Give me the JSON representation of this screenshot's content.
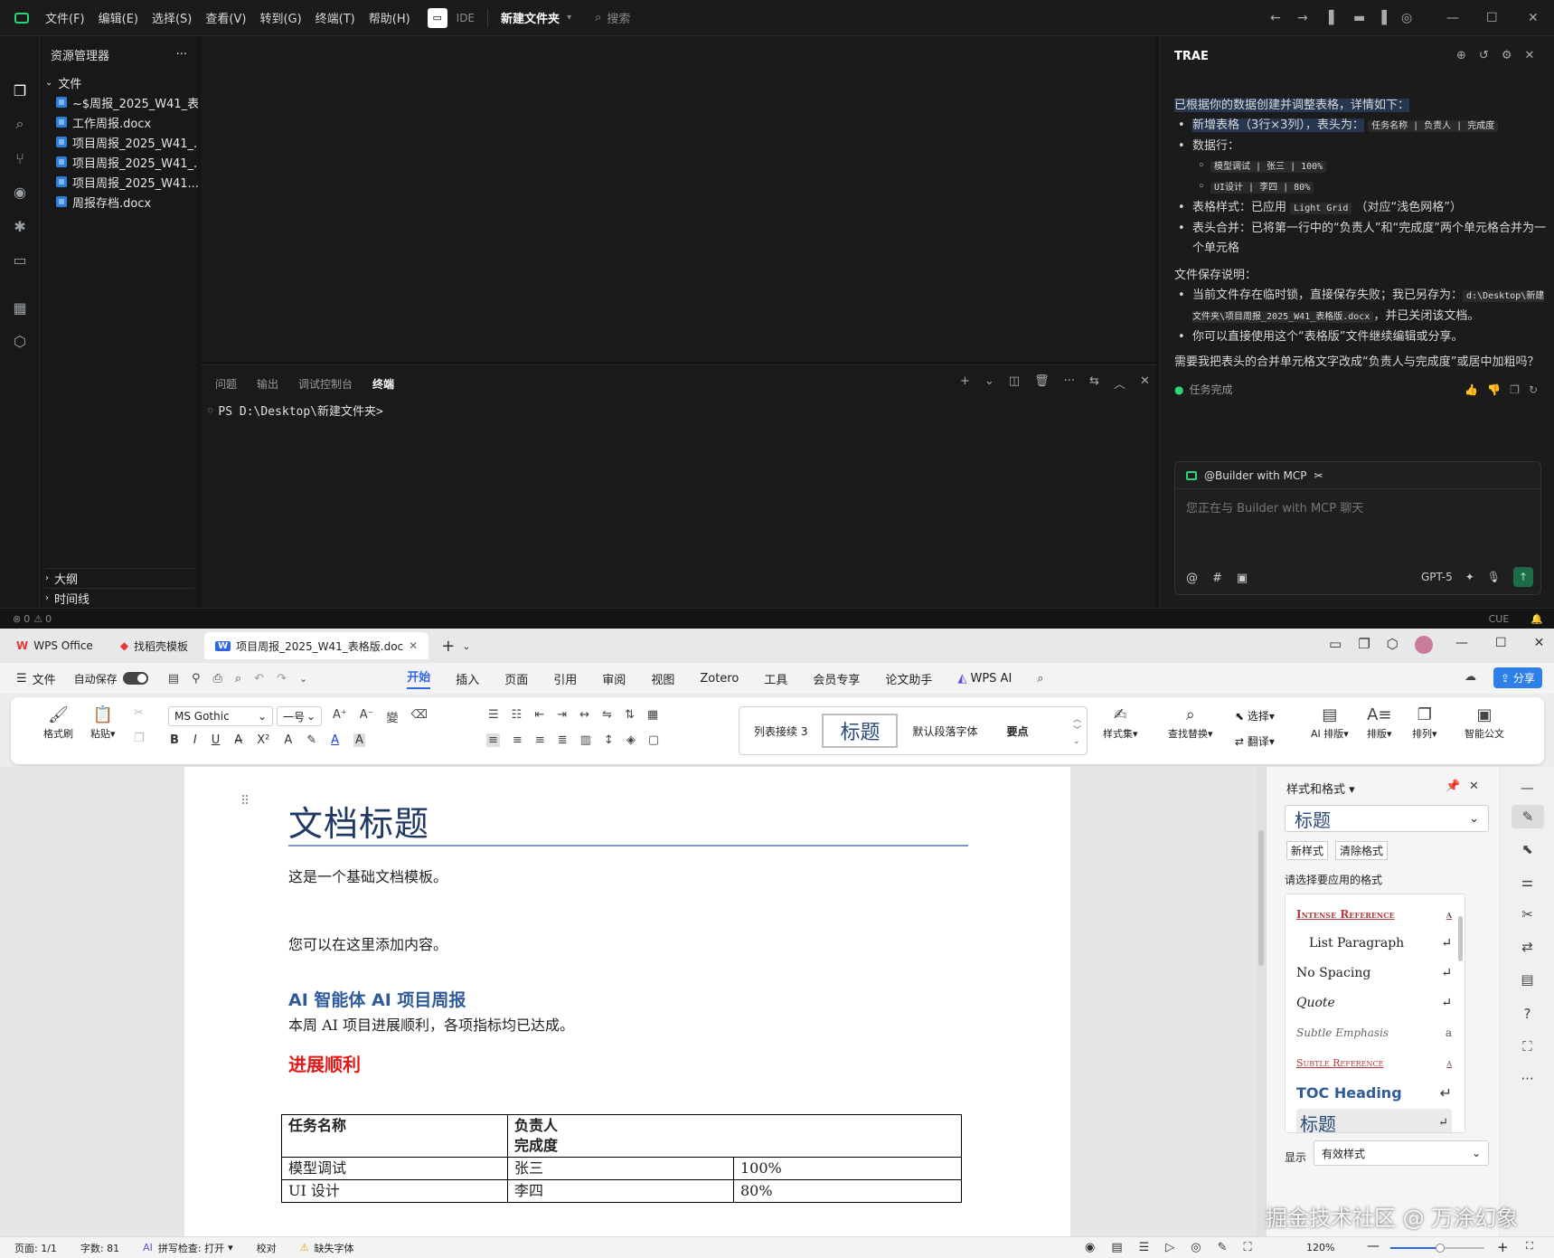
{
  "ide": {
    "menu": [
      "文件(F)",
      "编辑(E)",
      "选择(S)",
      "查看(V)",
      "转到(G)",
      "终端(T)",
      "帮助(H)"
    ],
    "mode_label": "IDE",
    "project": "新建文件夹",
    "search_placeholder": "搜索",
    "explorer": {
      "title": "资源管理器",
      "root": "文件",
      "files": [
        "~$周报_2025_W41_表...",
        "工作周报.docx",
        "项目周报_2025_W41_...",
        "项目周报_2025_W41_...",
        "项目周报_2025_W41....",
        "周报存档.docx"
      ],
      "outline": "大纲",
      "timeline": "时间线"
    },
    "panel": {
      "tabs": [
        "问题",
        "输出",
        "调试控制台",
        "终端"
      ],
      "active_tab": "终端",
      "prompt": "PS D:\\Desktop\\新建文件夹>"
    },
    "status": {
      "errors": "0",
      "warnings": "0",
      "right": "CUE"
    }
  },
  "trae": {
    "title": "TRAE",
    "intro": "已根据你的数据创建并调整表格，详情如下：",
    "b1_a": "新增表格（3行×3列），表头为：",
    "b1_code": "任务名称 | 负责人 | 完成度",
    "b2": "数据行：",
    "row1": "模型调试 | 张三 | 100%",
    "row2": "UI设计 | 李四 | 80%",
    "b3_a": "表格样式：已应用",
    "b3_code": "Light Grid",
    "b3_b": "（对应“浅色网格”）",
    "b4": "表头合并：已将第一行中的“负责人”和“完成度”两个单元格合并为一个单元格",
    "save_title": "文件保存说明：",
    "s1_a": "当前文件存在临时锁，直接保存失败；我已另存为：",
    "s1_code": "d:\\Desktop\\新建文件夹\\项目周报_2025_W41_表格版.docx",
    "s1_b": "，并已关闭该文档。",
    "s2": "你可以直接使用这个“表格版”文件继续编辑或分享。",
    "question": "需要我把表头的合并单元格文字改成“负责人与完成度”或居中加粗吗？",
    "done": "任务完成",
    "agent": "@Builder with MCP",
    "input_placeholder": "您正在与 Builder with MCP 聊天",
    "model": "GPT-5"
  },
  "wps": {
    "tabs": [
      "WPS Office",
      "找稻壳模板",
      "项目周报_2025_W41_表格版.doc"
    ],
    "file_menu": "文件",
    "autosave": "自动保存",
    "ribbon_tabs": [
      "开始",
      "插入",
      "页面",
      "引用",
      "审阅",
      "视图",
      "Zotero",
      "工具",
      "会员专享",
      "论文助手",
      "WPS AI"
    ],
    "active_ribbon_tab": "开始",
    "share": "分享",
    "font_name": "MS Gothic",
    "font_size": "一号",
    "buttons": {
      "format_painter": "格式刷",
      "paste": "粘贴",
      "style_set": "样式集",
      "find_replace": "查找替换",
      "select": "选择",
      "translate": "翻译",
      "ai_layout": "AI 排版",
      "layout": "排版",
      "arrange": "排列",
      "smart_doc": "智能公文"
    },
    "gallery": [
      "列表接续 3",
      "标题",
      "默认段落字体",
      "要点"
    ],
    "doc": {
      "title": "文档标题",
      "p1": "这是一个基础文档模板。",
      "p2": "您可以在这里添加内容。",
      "h1": "AI 智能体 AI 项目周报",
      "p3": "本周 AI 项目进展顺利，各项指标均已达成。",
      "h2": "进展顺利",
      "table": {
        "header": [
          "任务名称",
          "负责人",
          "完成度"
        ],
        "rows": [
          [
            "模型调试",
            "张三",
            "100%"
          ],
          [
            "UI 设计",
            "李四",
            "80%"
          ]
        ]
      }
    },
    "styles_panel": {
      "title": "样式和格式",
      "current": "标题",
      "new_style": "新样式",
      "clear_format": "清除格式",
      "prompt": "请选择要应用的格式",
      "items": [
        "Intense Reference",
        "List Paragraph",
        "No Spacing",
        "Quote",
        "Subtle Emphasis",
        "Subtle Reference",
        "TOC Heading",
        "标题"
      ],
      "show_label": "显示",
      "show_value": "有效样式"
    },
    "status": {
      "page": "页面: 1/1",
      "words": "字数: 81",
      "spell": "拼写检查: 打开",
      "proof": "校对",
      "missing_font": "缺失字体",
      "zoom": "120%"
    }
  },
  "watermark": "掘金技术社区 @ 万涂幻象"
}
